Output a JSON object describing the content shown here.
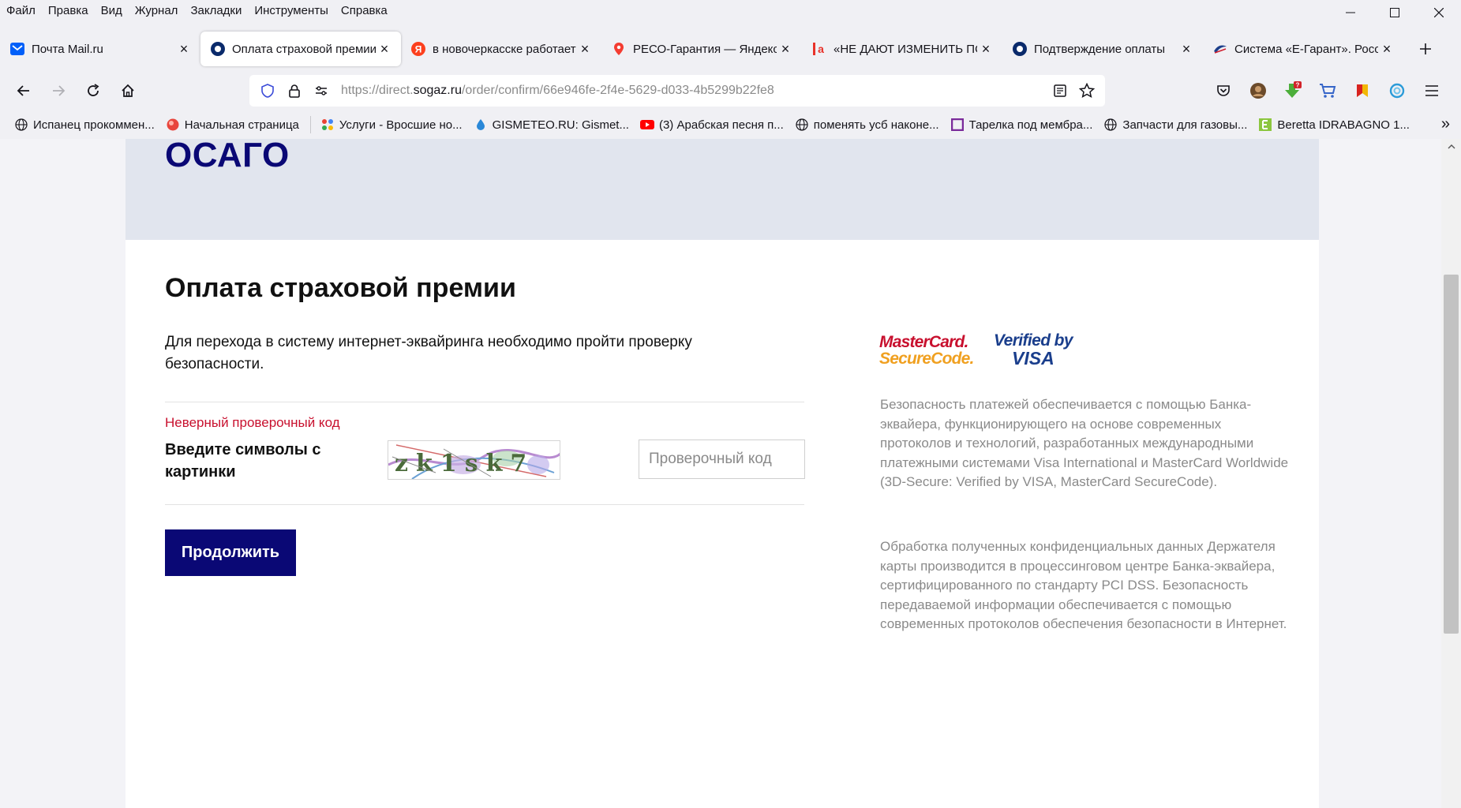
{
  "menu": [
    "Файл",
    "Правка",
    "Вид",
    "Журнал",
    "Закладки",
    "Инструменты",
    "Справка"
  ],
  "tabs": [
    {
      "title": "Почта Mail.ru",
      "icon": "mail-icon",
      "color": "#005ff9",
      "active": false
    },
    {
      "title": "Оплата страховой премии",
      "icon": "sogaz-icon",
      "color": "#0a2a6b",
      "active": true
    },
    {
      "title": "в новочеркасске работает",
      "icon": "yandex-icon",
      "color": "#fc3f1d",
      "active": false
    },
    {
      "title": "РЕСО-Гарантия — Яндекс К",
      "icon": "map-pin-icon",
      "color": "#f43c31",
      "active": false
    },
    {
      "title": "«НЕ ДАЮТ ИЗМЕНИТЬ ПОЛ",
      "icon": "lettera-icon",
      "color": "#e8322a",
      "active": false
    },
    {
      "title": "Подтверждение оплаты",
      "icon": "sogaz-icon",
      "color": "#0a2a6b",
      "active": false
    },
    {
      "title": "Система «Е-Гарант». Росси",
      "icon": "egarant-icon",
      "color": "#1d3f8a",
      "active": false
    }
  ],
  "url": {
    "prefix": "https://direct.",
    "domain": "sogaz.ru",
    "path": "/order/confirm/66e946fe-2f4e-5629-d033-4b5299b22fe8"
  },
  "bookmarks": [
    {
      "label": "Испанец прокоммен...",
      "icon": "globe-icon"
    },
    {
      "label": "Начальная страница",
      "icon": "opera-ball-icon"
    },
    {
      "label": "Услуги - Вросшие но...",
      "icon": "dots-icon"
    },
    {
      "label": "GISMETEO.RU: Gismet...",
      "icon": "drop-icon"
    },
    {
      "label": "(3) Арабская песня п...",
      "icon": "youtube-icon"
    },
    {
      "label": "поменять усб наконе...",
      "icon": "globe-icon"
    },
    {
      "label": "Тарелка под мембра...",
      "icon": "square-icon"
    },
    {
      "label": "Запчасти для газовы...",
      "icon": "globe-icon"
    },
    {
      "label": "Beretta IDRABAGNO 1...",
      "icon": "bracket-icon"
    }
  ],
  "page": {
    "header_title": "ОСАГО",
    "title": "Оплата страховой премии",
    "intro": "Для перехода в систему интернет-эквайринга необходимо пройти проверку безопасности.",
    "error": "Неверный проверочный код",
    "captcha_label": "Введите символы с картинки",
    "captcha_text": "zk1sk7",
    "input_placeholder": "Проверочный код",
    "submit_label": "Продолжить",
    "mastercard_line1": "MasterCard.",
    "mastercard_line2": "SecureCode.",
    "visa_line1": "Verified by",
    "visa_line2": "VISA",
    "security_text": "Безопасность платежей обеспечивается с помощью Банка-эквайера, функционирующего на основе современных протоколов и технологий, разработанных международными платежными системами Visa International и MasterCard Worldwide (3D-Secure: Verified by VISA, MasterCard SecureCode).",
    "processing_text": "Обработка полученных конфиденциальных данных Держателя карты производится в процессинговом центре Банка-эквайера, сертифицированного по стандарту PCI DSS. Безопасность передаваемой информации обеспечивается с помощью современных протоколов обеспечения безопасности в Интернет."
  },
  "colors": {
    "brand": "#0a0875",
    "error": "#c8102e",
    "header_bg": "#e1e5ee",
    "muted": "#8a8a8a"
  }
}
